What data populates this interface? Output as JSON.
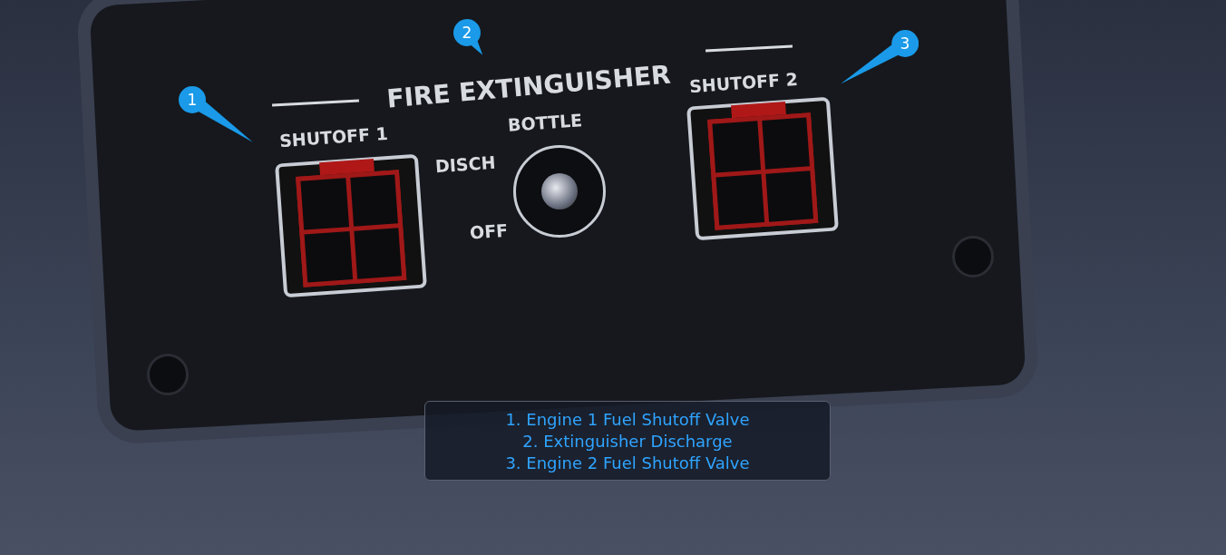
{
  "panel": {
    "title": "FIRE EXTINGUISHER",
    "switches": [
      {
        "label": "SHUTOFF 1",
        "on": false
      },
      {
        "label": "SHUTOFF 2",
        "on": false
      }
    ],
    "bottle": {
      "label": "BOTTLE",
      "positions": [
        "DISCH",
        "OFF"
      ],
      "on": false
    }
  },
  "callouts": [
    "1",
    "2",
    "3"
  ],
  "legend": [
    "1. Engine 1 Fuel Shutoff Valve",
    "2. Extinguisher Discharge",
    "3. Engine 2 Fuel Shutoff Valve"
  ]
}
